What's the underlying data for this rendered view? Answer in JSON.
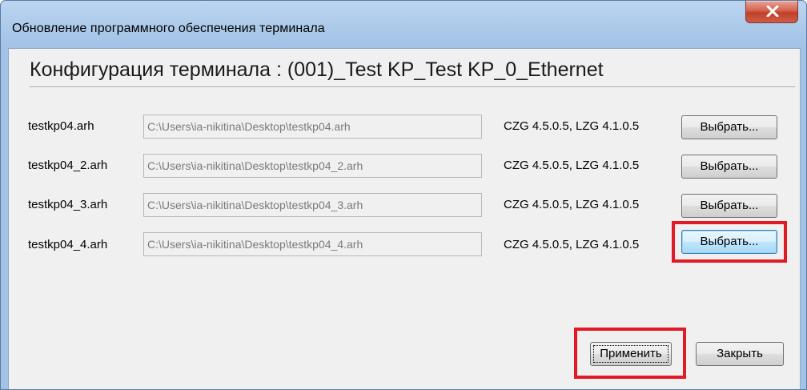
{
  "window": {
    "title": "Обновление программного обеспечения терминала",
    "close_glyph": "x"
  },
  "config_title": "Конфигурация терминала : (001)_Test KP_Test KP_0_Ethernet",
  "rows": [
    {
      "label": "testkp04.arh",
      "path": "C:\\Users\\ia-nikitina\\Desktop\\testkp04.arh",
      "version": "CZG 4.5.0.5, LZG 4.1.0.5",
      "button": "Выбрать..."
    },
    {
      "label": "testkp04_2.arh",
      "path": "C:\\Users\\ia-nikitina\\Desktop\\testkp04_2.arh",
      "version": "CZG 4.5.0.5, LZG 4.1.0.5",
      "button": "Выбрать..."
    },
    {
      "label": "testkp04_3.arh",
      "path": "C:\\Users\\ia-nikitina\\Desktop\\testkp04_3.arh",
      "version": "CZG 4.5.0.5, LZG 4.1.0.5",
      "button": "Выбрать..."
    },
    {
      "label": "testkp04_4.arh",
      "path": "C:\\Users\\ia-nikitina\\Desktop\\testkp04_4.arh",
      "version": "CZG 4.5.0.5, LZG 4.1.0.5",
      "button": "Выбрать..."
    }
  ],
  "footer": {
    "apply_label": "Применить",
    "close_label": "Закрыть"
  },
  "colors": {
    "highlight": "#e11a24",
    "titlebar": "#a9c7e8",
    "client_bg": "#f0f0f0"
  },
  "icons": {
    "close": "close-icon"
  }
}
